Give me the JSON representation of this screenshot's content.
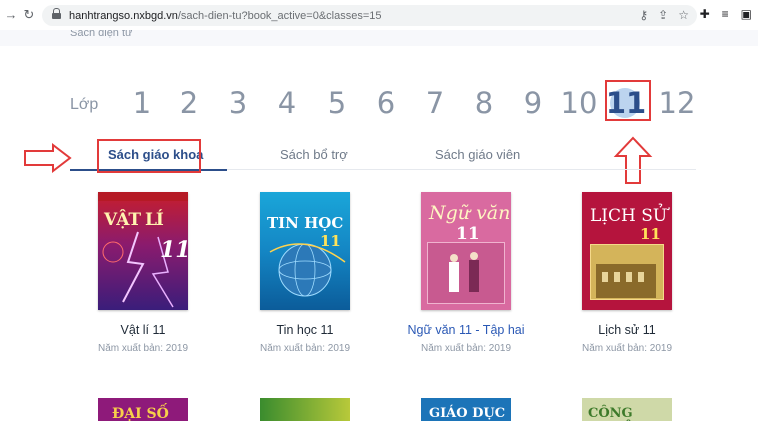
{
  "browser": {
    "url_host": "hanhtrangso.nxbgd.vn",
    "url_path": "/sach-dien-tu?book_active=0&classes=15"
  },
  "header": {
    "breadcrumb": "Sách điện tử"
  },
  "classes": {
    "label": "Lớp",
    "numbers": [
      "1",
      "2",
      "3",
      "4",
      "5",
      "6",
      "7",
      "8",
      "9",
      "10",
      "11",
      "12"
    ],
    "selected": "11"
  },
  "tabs": [
    {
      "label": "Sách giáo khoa",
      "active": true
    },
    {
      "label": "Sách bổ trợ",
      "active": false
    },
    {
      "label": "Sách giáo viên",
      "active": false
    }
  ],
  "books": [
    {
      "title": "Vật lí 11",
      "year": "Năm xuất bản: 2019",
      "cover_text": "VẬT LÍ",
      "cover_num": "11",
      "highlighted": false
    },
    {
      "title": "Tin học 11",
      "year": "Năm xuất bản: 2019",
      "cover_text": "TIN HỌC",
      "cover_num": "11",
      "highlighted": false
    },
    {
      "title": "Ngữ văn 11 - Tập hai",
      "year": "Năm xuất bản: 2019",
      "cover_text": "Ngữ văn",
      "cover_num": "11",
      "highlighted": true
    },
    {
      "title": "Lịch sử 11",
      "year": "Năm xuất bản: 2019",
      "cover_text": "LỊCH SỬ",
      "cover_num": "11",
      "highlighted": false
    }
  ],
  "next_row_cover_texts": [
    "ĐẠI SỐ",
    "",
    "GIÁO DỤC",
    "CÔNG NGHỆ"
  ],
  "colors": {
    "brand_blue": "#2c4e8a",
    "annotation_red": "#e23a3a",
    "muted_text": "#8a95a5"
  }
}
